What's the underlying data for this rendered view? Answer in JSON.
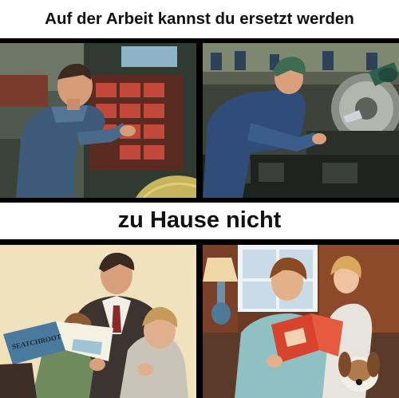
{
  "meme": {
    "top_caption": "Auf der Arbeit kannst du ersetzt werden",
    "middle_caption": "zu Hause nicht",
    "book_cover_text": "SEATCHROOT"
  },
  "colors": {
    "caption_text": "#111111",
    "divider": "#000000",
    "background": "#ffffff"
  }
}
